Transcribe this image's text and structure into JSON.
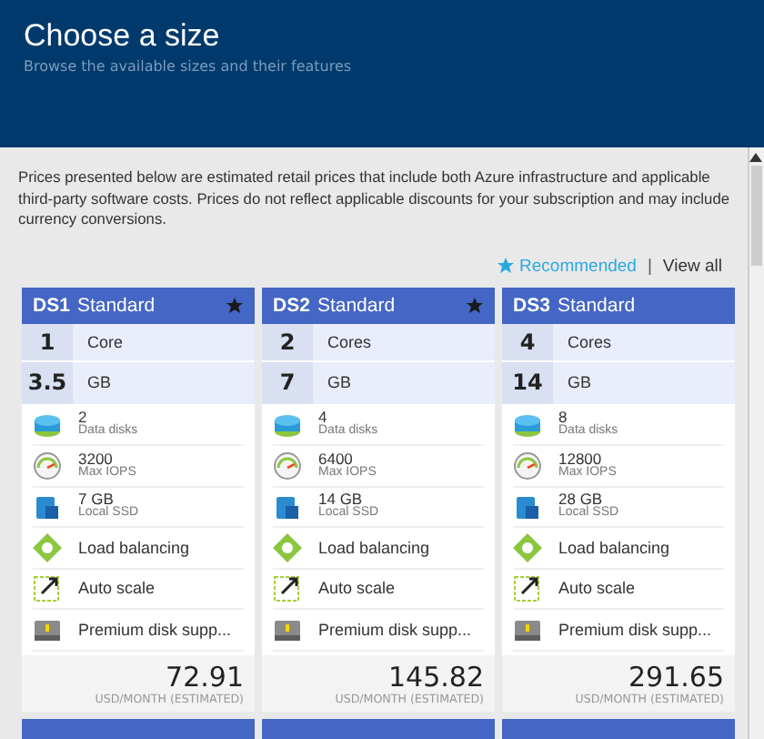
{
  "header": {
    "title": "Choose a size",
    "subtitle": "Browse the available sizes and their features"
  },
  "notice": "Prices presented below are estimated retail prices that include both Azure infrastructure and applicable third-party software costs. Prices do not reflect applicable discounts for your subscription and may include currency conversions.",
  "filter": {
    "recommended": "Recommended",
    "separator": "|",
    "view_all": "View all"
  },
  "cards": [
    {
      "name": "DS1",
      "tier": "Standard",
      "recommended": true,
      "cores": "1",
      "cores_label": "Core",
      "memory": "3.5",
      "memory_label": "GB",
      "features": [
        {
          "kind": "disks",
          "value": "2",
          "label": "Data disks"
        },
        {
          "kind": "iops",
          "value": "3200",
          "label": "Max IOPS"
        },
        {
          "kind": "ssd",
          "value": "7 GB",
          "label": "Local SSD"
        },
        {
          "kind": "balance",
          "label": "Load balancing"
        },
        {
          "kind": "scale",
          "label": "Auto scale"
        },
        {
          "kind": "premium",
          "label": "Premium disk supp..."
        }
      ],
      "price": "72.91",
      "price_unit": "USD/MONTH (ESTIMATED)"
    },
    {
      "name": "DS2",
      "tier": "Standard",
      "recommended": true,
      "cores": "2",
      "cores_label": "Cores",
      "memory": "7",
      "memory_label": "GB",
      "features": [
        {
          "kind": "disks",
          "value": "4",
          "label": "Data disks"
        },
        {
          "kind": "iops",
          "value": "6400",
          "label": "Max IOPS"
        },
        {
          "kind": "ssd",
          "value": "14 GB",
          "label": "Local SSD"
        },
        {
          "kind": "balance",
          "label": "Load balancing"
        },
        {
          "kind": "scale",
          "label": "Auto scale"
        },
        {
          "kind": "premium",
          "label": "Premium disk supp..."
        }
      ],
      "price": "145.82",
      "price_unit": "USD/MONTH (ESTIMATED)"
    },
    {
      "name": "DS3",
      "tier": "Standard",
      "recommended": false,
      "cores": "4",
      "cores_label": "Cores",
      "memory": "14",
      "memory_label": "GB",
      "features": [
        {
          "kind": "disks",
          "value": "8",
          "label": "Data disks"
        },
        {
          "kind": "iops",
          "value": "12800",
          "label": "Max IOPS"
        },
        {
          "kind": "ssd",
          "value": "28 GB",
          "label": "Local SSD"
        },
        {
          "kind": "balance",
          "label": "Load balancing"
        },
        {
          "kind": "scale",
          "label": "Auto scale"
        },
        {
          "kind": "premium",
          "label": "Premium disk supp..."
        }
      ],
      "price": "291.65",
      "price_unit": "USD/MONTH (ESTIMATED)"
    }
  ]
}
